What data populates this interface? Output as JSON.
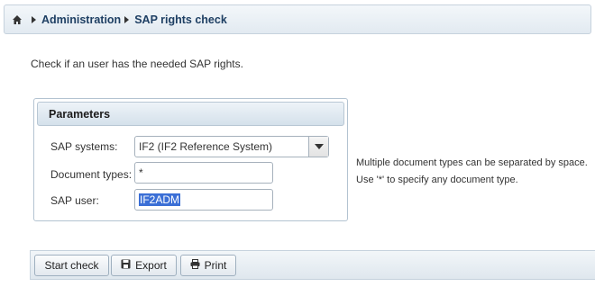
{
  "breadcrumb": {
    "home_icon": "home-icon",
    "items": [
      "Administration",
      "SAP rights check"
    ]
  },
  "intro_text": "Check if an user has the needed SAP rights.",
  "parameters": {
    "title": "Parameters",
    "sap_systems": {
      "label": "SAP systems:",
      "value": "IF2 (IF2 Reference System)"
    },
    "document_types": {
      "label": "Document types:",
      "value": "*"
    },
    "sap_user": {
      "label": "SAP user:",
      "value": "IF2ADM"
    }
  },
  "hints": [
    "Multiple document types can be separated by space.",
    "Use '*' to specify any document type."
  ],
  "toolbar": {
    "start_check": "Start check",
    "export": "Export",
    "print": "Print",
    "export_icon": "save-icon",
    "print_icon": "printer-icon"
  }
}
